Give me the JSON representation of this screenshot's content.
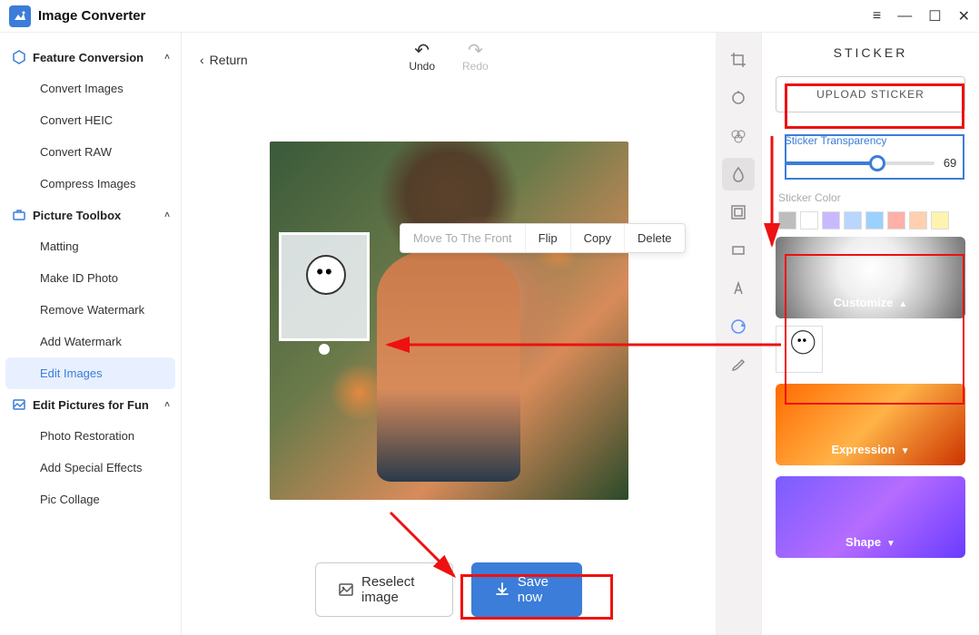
{
  "app": {
    "title": "Image Converter"
  },
  "window_controls": {
    "menu": "≡",
    "min": "—",
    "max": "☐",
    "close": "✕"
  },
  "sidebar": {
    "groups": [
      {
        "label": "Feature Conversion",
        "expanded": true,
        "items": [
          "Convert Images",
          "Convert HEIC",
          "Convert RAW",
          "Compress Images"
        ]
      },
      {
        "label": "Picture Toolbox",
        "expanded": true,
        "items": [
          "Matting",
          "Make ID Photo",
          "Remove Watermark",
          "Add Watermark",
          "Edit Images"
        ],
        "active_index": 4
      },
      {
        "label": "Edit Pictures for Fun",
        "expanded": true,
        "items": [
          "Photo Restoration",
          "Add Special Effects",
          "Pic Collage"
        ]
      }
    ]
  },
  "canvas": {
    "return": "Return",
    "undo": "Undo",
    "redo": "Redo",
    "context_menu": [
      "Move To The Front",
      "Flip",
      "Copy",
      "Delete"
    ],
    "reselect": "Reselect image",
    "save": "Save now"
  },
  "tools": [
    "crop",
    "adjust",
    "filter",
    "drop",
    "frame",
    "ratio",
    "text",
    "sticker",
    "brush"
  ],
  "sticker_panel": {
    "title": "STICKER",
    "upload": "UPLOAD STICKER",
    "transparency_label": "Sticker Transparency",
    "transparency_value": 69,
    "color_label": "Sticker Color",
    "colors": [
      "#bdbdbd",
      "#ffffff",
      "#c8b9ff",
      "#b9d6ff",
      "#9cd1ff",
      "#ffb0a8",
      "#ffd0b0",
      "#fff3b0"
    ],
    "categories": [
      {
        "name": "Customize",
        "expanded": true,
        "items": [
          "panda-sticker"
        ]
      },
      {
        "name": "Expression",
        "expanded": false
      },
      {
        "name": "Shape",
        "expanded": false
      }
    ]
  }
}
